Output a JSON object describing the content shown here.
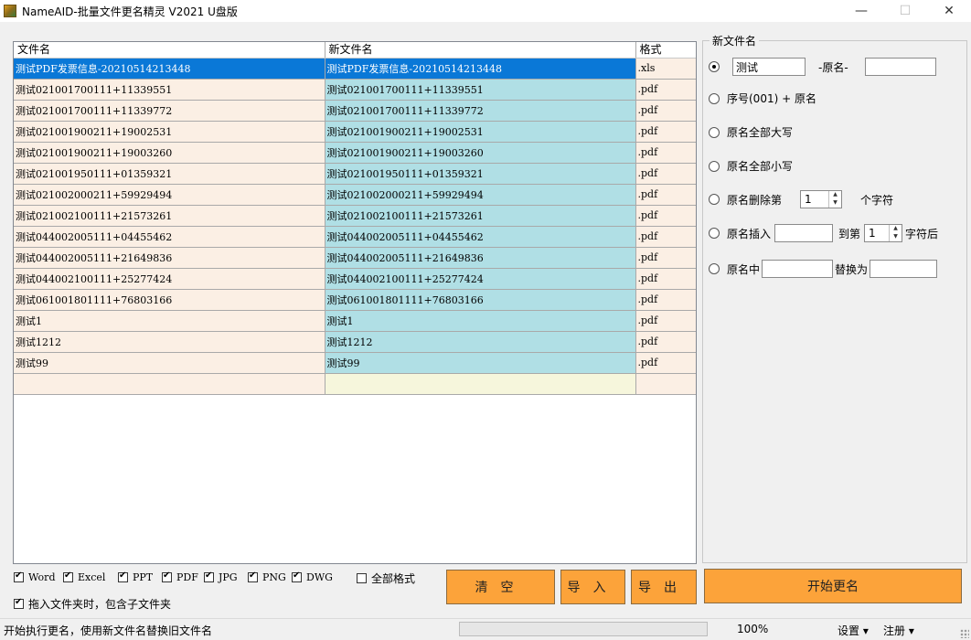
{
  "window": {
    "title": "NameAID-批量文件更名精灵 V2021 U盘版",
    "minimize": "—",
    "maximize": "☐",
    "close": "✕"
  },
  "grid": {
    "columns": [
      "文件名",
      "新文件名",
      "格式"
    ],
    "rows": [
      [
        "测试PDF发票信息-20210514213448",
        "测试PDF发票信息-20210514213448",
        ".xls"
      ],
      [
        "测试021001700111+11339551",
        "测试021001700111+11339551",
        ".pdf"
      ],
      [
        "测试021001700111+11339772",
        "测试021001700111+11339772",
        ".pdf"
      ],
      [
        "测试021001900211+19002531",
        "测试021001900211+19002531",
        ".pdf"
      ],
      [
        "测试021001900211+19003260",
        "测试021001900211+19003260",
        ".pdf"
      ],
      [
        "测试021001950111+01359321",
        "测试021001950111+01359321",
        ".pdf"
      ],
      [
        "测试021002000211+59929494",
        "测试021002000211+59929494",
        ".pdf"
      ],
      [
        "测试021002100111+21573261",
        "测试021002100111+21573261",
        ".pdf"
      ],
      [
        "测试044002005111+04455462",
        "测试044002005111+04455462",
        ".pdf"
      ],
      [
        "测试044002005111+21649836",
        "测试044002005111+21649836",
        ".pdf"
      ],
      [
        "测试044002100111+25277424",
        "测试044002100111+25277424",
        ".pdf"
      ],
      [
        "测试061001801111+76803166",
        "测试061001801111+76803166",
        ".pdf"
      ],
      [
        "测试1",
        "测试1",
        ".pdf"
      ],
      [
        "测试1212",
        "测试1212",
        ".pdf"
      ],
      [
        "测试99",
        "测试99",
        ".pdf"
      ],
      [
        "",
        "",
        ""
      ]
    ],
    "selected_row": 0
  },
  "panel": {
    "legend": "新文件名",
    "opt1": {
      "prefix_value": "测试",
      "mid_label": "-原名-",
      "suffix_value": ""
    },
    "opt2": {
      "label": "序号(001) + 原名"
    },
    "opt3": {
      "label": "原名全部大写"
    },
    "opt4": {
      "label": "原名全部小写"
    },
    "opt5": {
      "label": "原名删除第",
      "count": "1",
      "unit": "个字符"
    },
    "opt6": {
      "label": "原名插入",
      "value": "",
      "to_label": "到第",
      "pos": "1",
      "after_label": "字符后"
    },
    "opt7": {
      "label": "原名中",
      "from_value": "",
      "replace_label": "替换为",
      "to_value": ""
    },
    "selected": 1
  },
  "filters": {
    "word": "Word",
    "excel": "Excel",
    "ppt": "PPT",
    "pdf": "PDF",
    "jpg": "JPG",
    "png": "PNG",
    "dwg": "DWG",
    "all": "全部格式",
    "subfolder": "拖入文件夹时，包含子文件夹"
  },
  "buttons": {
    "clear": "清空",
    "import": "导入",
    "export": "导出",
    "start": "开始更名"
  },
  "status": {
    "text": "开始执行更名，使用新文件名替换旧文件名",
    "progress": 0,
    "zoom": "100%",
    "settings": "设置 ▾",
    "register": "注册 ▾"
  },
  "colors": {
    "selected_row": "#0a78d7",
    "name_cell": "#fbefe4",
    "new_name_cell": "#b0dfe5",
    "orange_button": "#fca33a"
  }
}
